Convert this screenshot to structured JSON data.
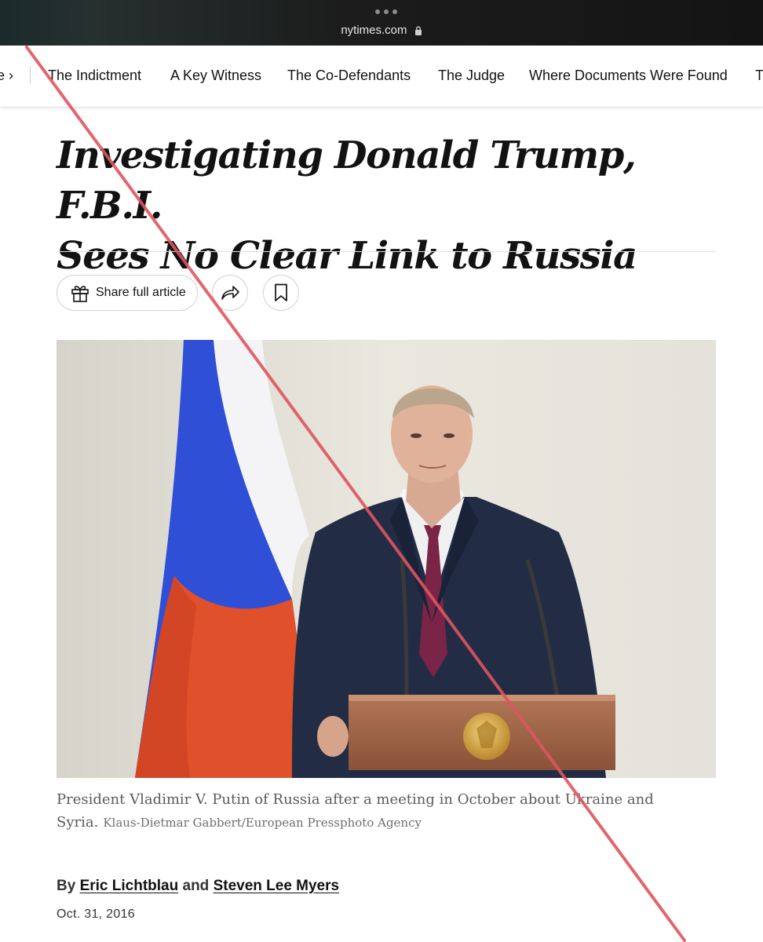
{
  "browser": {
    "url": "nytimes.com"
  },
  "section_nav": {
    "prev_item": "e ›",
    "items": [
      "The Indictment",
      "A Key Witness",
      "The Co-Defendants",
      "The Judge",
      "Where Documents Were Found",
      "T"
    ]
  },
  "article": {
    "headline_line1": "Investigating Donald Trump, F.B.I.",
    "headline_line2": "Sees No Clear Link to Russia",
    "share_full_label": "Share full article",
    "caption": "President Vladimir V. Putin of Russia after a meeting in October about Ukraine and Syria.",
    "credit": "Klaus-Dietmar Gabbert/European Pressphoto Agency",
    "byline_prefix": "By",
    "author1": "Eric Lichtblau",
    "byline_and": "and",
    "author2": "Steven Lee Myers",
    "date": "Oct. 31, 2016"
  },
  "colors": {
    "strike_line": "#e0555f",
    "flag_blue": "#2f4fd6",
    "flag_red": "#e0502a"
  }
}
